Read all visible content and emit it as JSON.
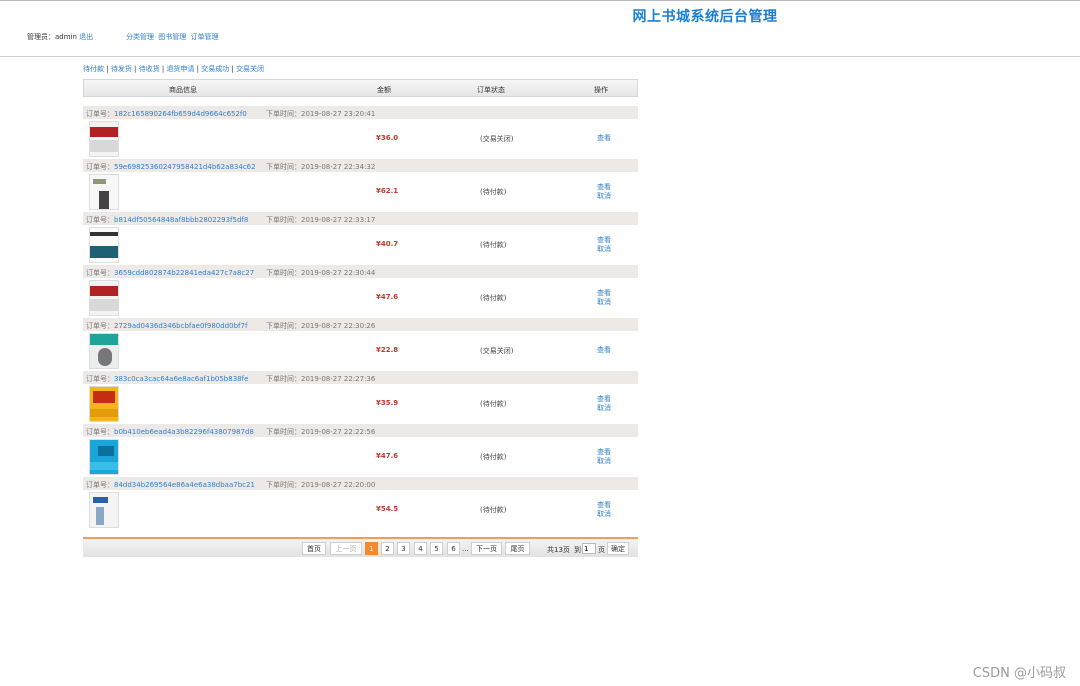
{
  "header": {
    "site_title": "网上书城系统后台管理",
    "admin_label": "管理员：",
    "admin_name": "admin",
    "logout": "退出",
    "nav": [
      "分类管理",
      "图书管理",
      "订单管理"
    ]
  },
  "status_filter": [
    "待付款",
    "待发货",
    "待收货",
    "退货申请",
    "交易成功",
    "交易关闭"
  ],
  "columns": {
    "product": "商品信息",
    "amount": "金额",
    "status": "订单状态",
    "actions": "操作"
  },
  "order_labels": {
    "order_no": "订单号：",
    "order_time": "下单时间："
  },
  "orders": [
    {
      "id": "182c165890264fb659d4d9664c652f0",
      "time": "2019-08-27 23:20:41",
      "amount": "¥36.0",
      "status": "(交易关闭)",
      "actions": [
        "查看"
      ],
      "cover": "java-red"
    },
    {
      "id": "59e69825360247958421d4b62a834c62",
      "time": "2019-08-27 22:34:32",
      "amount": "¥62.1",
      "status": "(待付款)",
      "actions": [
        "查看",
        "取消"
      ],
      "cover": "spring-white"
    },
    {
      "id": "b814df50564848af8bbb2802293f5df8",
      "time": "2019-08-27 22:33:17",
      "amount": "¥40.7",
      "status": "(待付款)",
      "actions": [
        "查看",
        "取消"
      ],
      "cover": "teal-dark"
    },
    {
      "id": "3659cdd802874b22841eda427c7a8c27",
      "time": "2019-08-27 22:30:44",
      "amount": "¥47.6",
      "status": "(待付款)",
      "actions": [
        "查看",
        "取消"
      ],
      "cover": "java-red"
    },
    {
      "id": "2729ad0436d346bcbfae0f980dd0bf7f",
      "time": "2019-08-27 22:30:26",
      "amount": "¥22.8",
      "status": "(交易关闭)",
      "actions": [
        "查看"
      ],
      "cover": "teal-bird"
    },
    {
      "id": "383c0ca3cac64a6e8ac6af1b05b838fe",
      "time": "2019-08-27 22:27:36",
      "amount": "¥35.9",
      "status": "(待付款)",
      "actions": [
        "查看",
        "取消"
      ],
      "cover": "effective-java"
    },
    {
      "id": "b0b410eb6ead4a3b82296f43807987d8",
      "time": "2019-08-27 22:22:56",
      "amount": "¥47.6",
      "status": "(待付款)",
      "actions": [
        "查看",
        "取消"
      ],
      "cover": "cyan-blue"
    },
    {
      "id": "84dd34b269564e86a4e6a38dbaa7bc21",
      "time": "2019-08-27 22:20:00",
      "amount": "¥54.5",
      "status": "(待付款)",
      "actions": [
        "查看",
        "取消"
      ],
      "cover": "white-blue"
    }
  ],
  "pagination": {
    "first": "首页",
    "prev": "上一页",
    "pages": [
      "1",
      "2",
      "3",
      "4",
      "5",
      "6"
    ],
    "current": "1",
    "ellipsis": "...",
    "next": "下一页",
    "last": "尾页",
    "total": "共13页",
    "goto": "到",
    "page_input": "1",
    "page_unit": "页",
    "confirm": "确定"
  },
  "watermark": "CSDN @小码叔",
  "colors": {
    "link": "#2c7fd0",
    "title": "#1a7fd4",
    "amount": "#c0392b",
    "pager_active": "#f5882d",
    "order_head_bg": "#ede9e6"
  }
}
